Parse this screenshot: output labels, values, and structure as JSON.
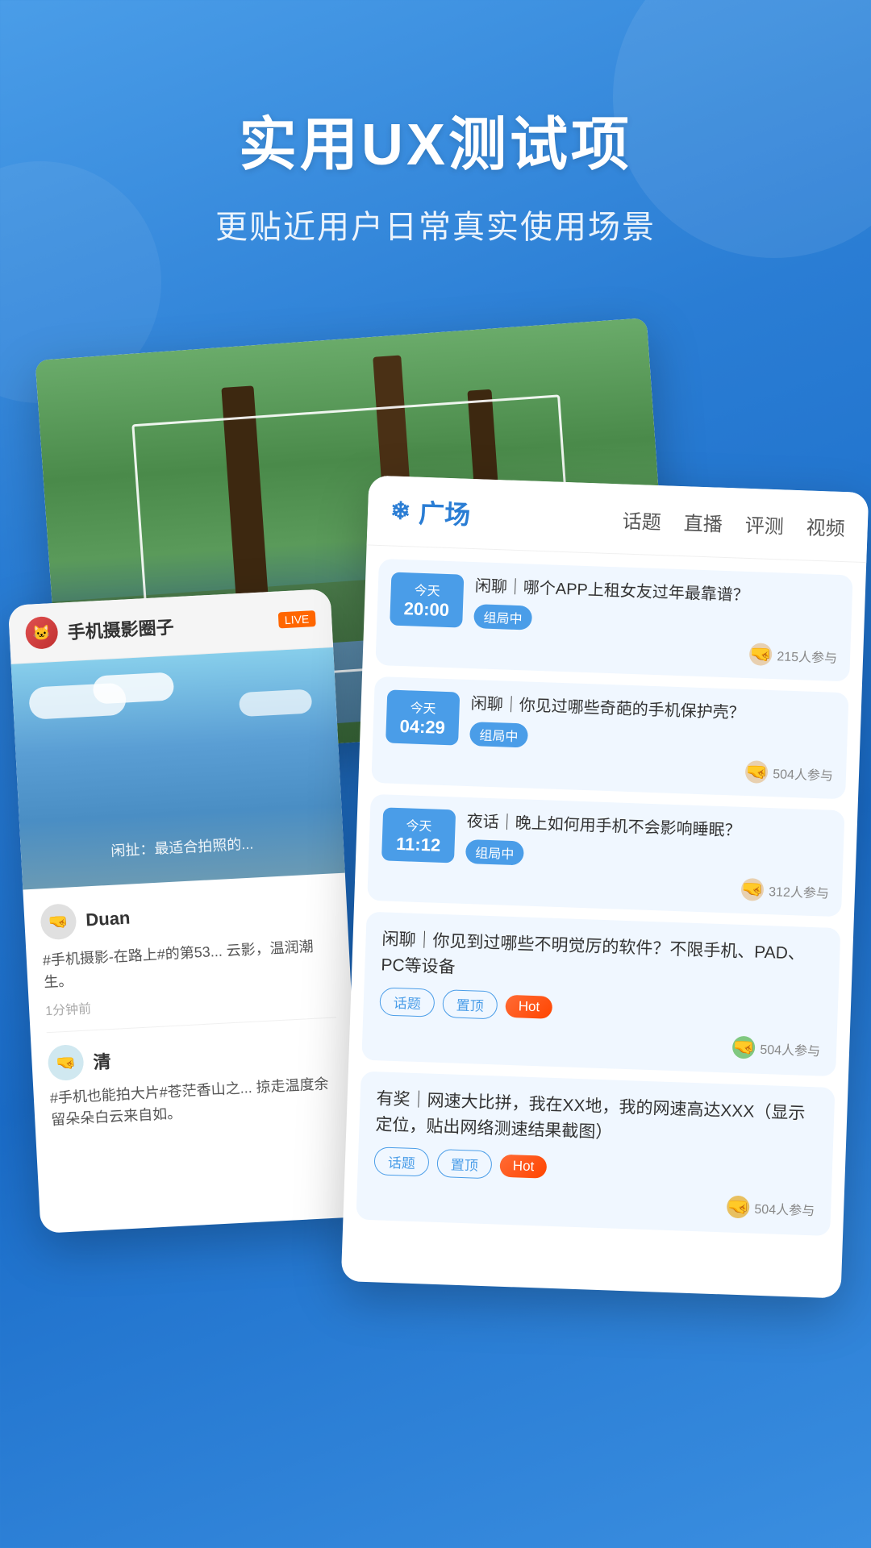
{
  "page": {
    "background": "#2a7dd4",
    "main_title": "实用UX测试项",
    "sub_title": "更贴近用户日常真实使用场景"
  },
  "photo_card": {
    "alt": "outdoor photo with trees"
  },
  "mobile_card": {
    "header": {
      "title": "手机摄影圈子",
      "badge": "LIVE"
    },
    "image_caption": "闲扯：最适合拍照的...",
    "user1": {
      "name": "Duan",
      "post": "#手机摄影-在路上#的第53...\n云影，温润潮生。",
      "time": "1分钟前"
    },
    "user2": {
      "name": "清",
      "post": "#手机也能拍大片#苍茫香山之...\n掠走温度余留朵朵白云来自如。"
    }
  },
  "forum_card": {
    "logo": "广场",
    "nav": [
      "话题",
      "直播",
      "评测",
      "视频"
    ],
    "topics": [
      {
        "time_label": "今天",
        "time_value": "20:00",
        "title": "闲聊｜哪个APP上租女友过年最靠谱？",
        "status": "组局中",
        "participants": "215人参与"
      },
      {
        "time_label": "今天",
        "time_value": "04:29",
        "title": "闲聊｜你见过哪些奇葩的手机保护壳？",
        "status": "组局中",
        "participants": "504人参与"
      },
      {
        "time_label": "今天",
        "time_value": "11:12",
        "title": "夜话｜晚上如何用手机不会影响睡眠？",
        "status": "组局中",
        "participants": "312人参与"
      }
    ],
    "flat_topics": [
      {
        "title": "闲聊｜你见到过哪些不明觉厉的软件？不限手机、PAD、PC等设备",
        "tags": [
          "话题",
          "置顶",
          "Hot"
        ],
        "participants": "504人参与"
      },
      {
        "title": "有奖｜网速大比拼，我在XX地，我的网速高达XXX（显示定位，贴出网络测速结果截图）",
        "tags": [
          "话题",
          "置顶",
          "Hot"
        ],
        "participants": "504人参与"
      }
    ]
  }
}
